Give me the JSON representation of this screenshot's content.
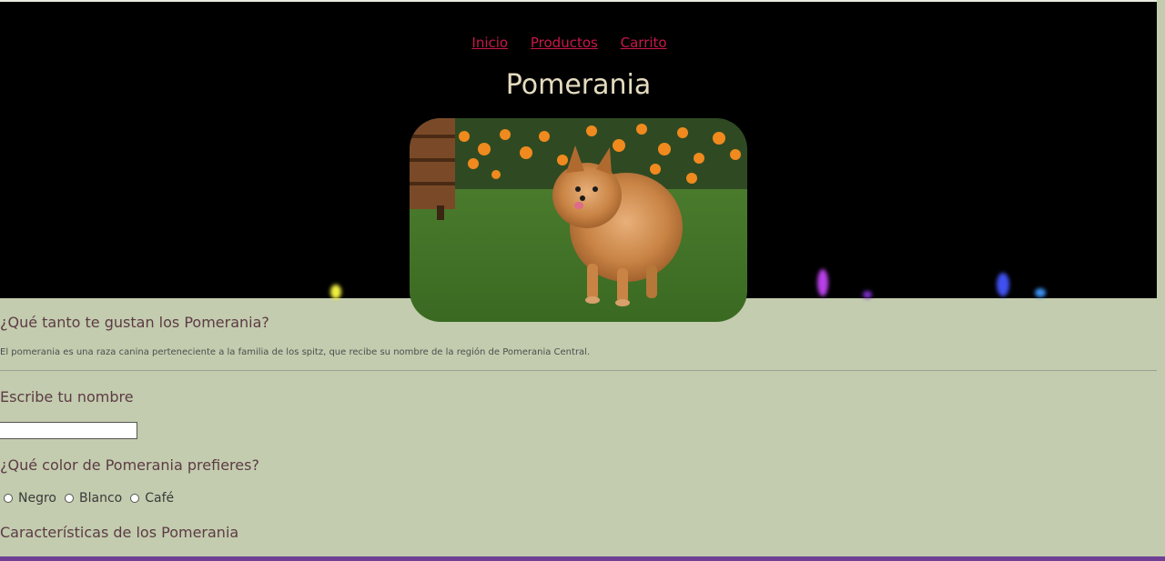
{
  "nav": {
    "items": [
      {
        "label": "Inicio"
      },
      {
        "label": "Productos"
      },
      {
        "label": "Carrito"
      }
    ]
  },
  "hero": {
    "title": "Pomerania",
    "image_alt": "pomeranian-dog-photo"
  },
  "content": {
    "question_like": "¿Qué tanto te gustan los Pomerania?",
    "description": "El pomerania es una raza canina perteneciente a la familia de los spitz, que recibe su nombre de la región de Pomerania Central.",
    "name_label": "Escribe tu nombre",
    "name_value": "",
    "color_question": "¿Qué color de Pomerania prefieres?",
    "color_options": [
      "Negro",
      "Blanco",
      "Café"
    ],
    "features_heading": "Características de los Pomerania"
  },
  "colors": {
    "page_bg": "#c3ccae",
    "hero_bg": "#000000",
    "link": "#c8174a",
    "title": "#e4dcc0",
    "heading": "#5c3b45",
    "bottom_bar": "#6f3f94"
  }
}
